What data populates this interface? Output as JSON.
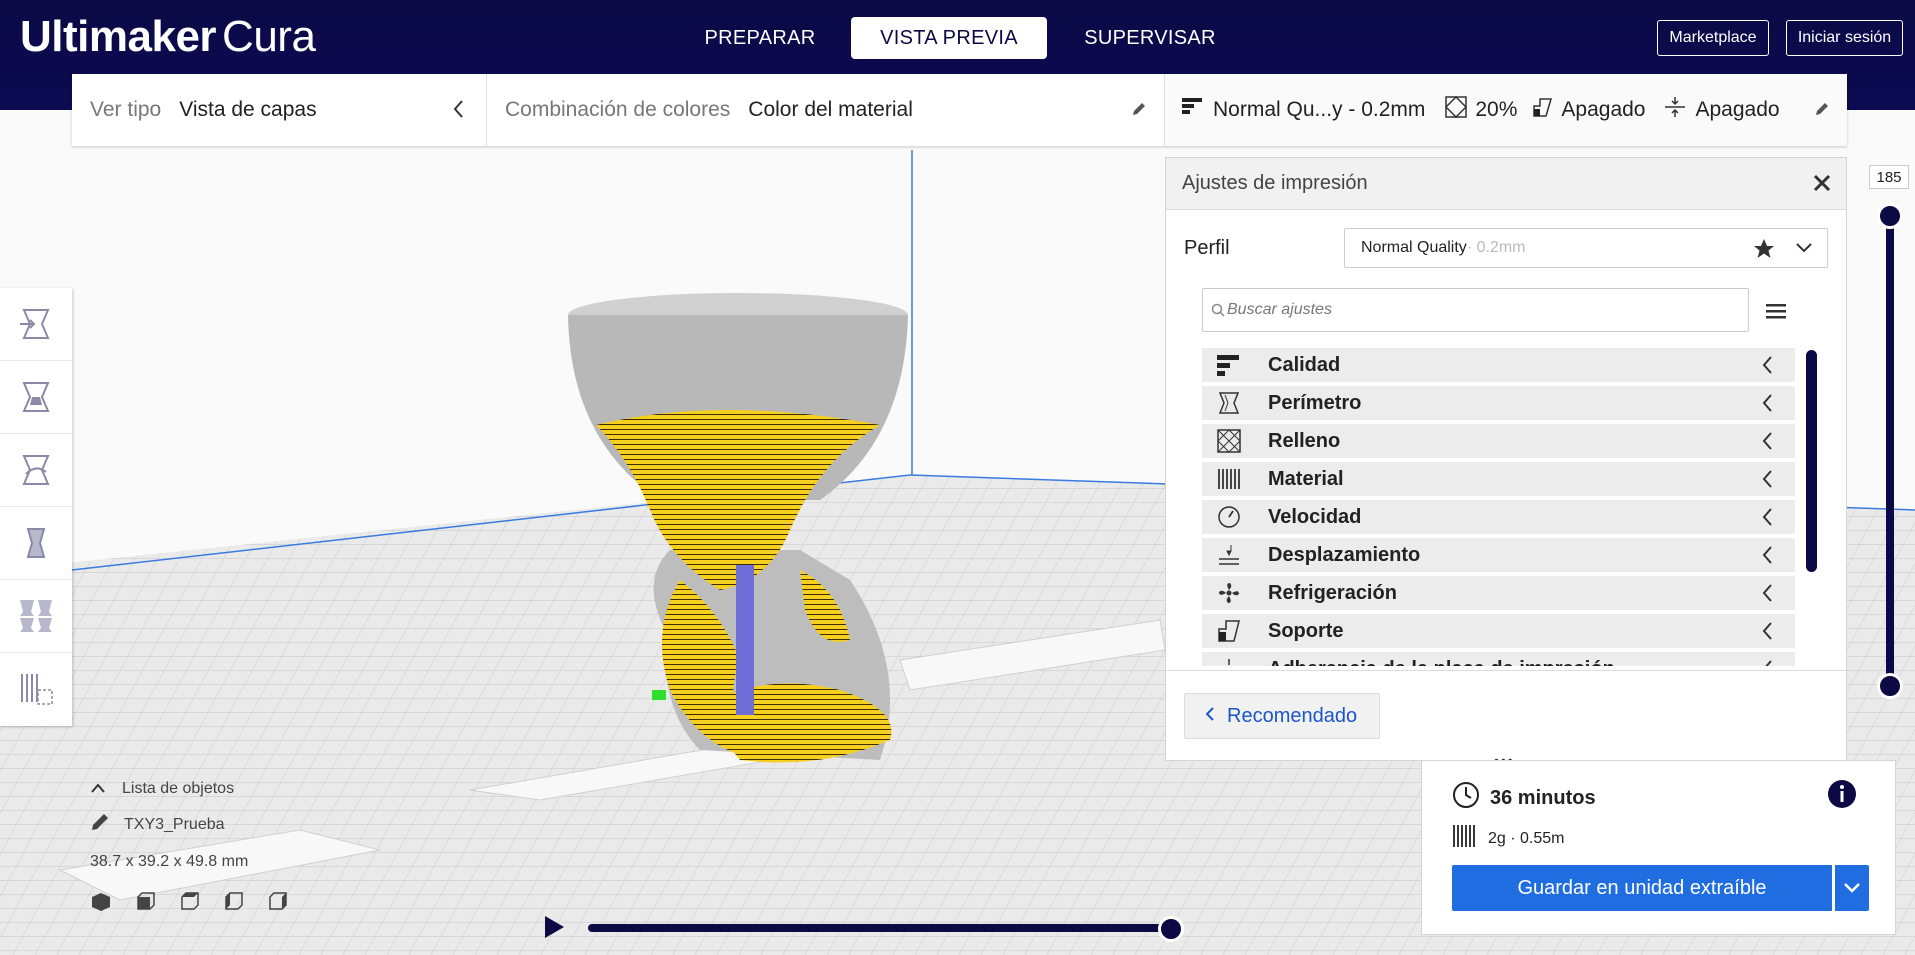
{
  "header": {
    "brand_bold": "Ultimaker",
    "brand_light": "Cura",
    "stages": [
      "PREPARAR",
      "VISTA PREVIA",
      "SUPERVISAR"
    ],
    "active_stage": "VISTA PREVIA",
    "marketplace": "Marketplace",
    "sign_in": "Iniciar sesión"
  },
  "view_bar": {
    "view_type_label": "Ver tipo",
    "view_type_value": "Vista de capas",
    "color_scheme_label": "Combinación de colores",
    "color_scheme_value": "Color del material",
    "print_profile": "Normal Qu...y - 0.2mm",
    "infill": "20%",
    "support": "Apagado",
    "adhesion": "Apagado"
  },
  "settings_panel": {
    "title": "Ajustes de impresión",
    "profile_label": "Perfil",
    "profile_name": "Normal Quality",
    "profile_suffix": " · 0.2mm",
    "search_placeholder": "Buscar ajustes",
    "categories": [
      {
        "label": "Calidad",
        "icon": "quality-icon"
      },
      {
        "label": "Perímetro",
        "icon": "shell-icon"
      },
      {
        "label": "Relleno",
        "icon": "infill-icon"
      },
      {
        "label": "Material",
        "icon": "material-icon"
      },
      {
        "label": "Velocidad",
        "icon": "speed-icon"
      },
      {
        "label": "Desplazamiento",
        "icon": "travel-icon"
      },
      {
        "label": "Refrigeración",
        "icon": "cooling-icon"
      },
      {
        "label": "Soporte",
        "icon": "support-icon"
      },
      {
        "label": "Adherencia de la placa de impresión",
        "icon": "adhesion-icon"
      }
    ],
    "recommended_button": "Recomendado"
  },
  "print_summary": {
    "time": "36 minutos",
    "material": "2g · 0.55m",
    "save_button": "Guardar en unidad extraíble"
  },
  "object_list": {
    "toggle_label": "Lista de objetos",
    "object_name": "TXY3_Prueba",
    "dimensions": "38.7 x 39.2 x 49.8 mm"
  },
  "layer_view": {
    "current_layer": "185"
  },
  "colors": {
    "header_bg": "#0c0944",
    "accent_blue": "#1f6de0",
    "model_yellow": "#f5d11f",
    "slider_dark": "#0c0944"
  }
}
